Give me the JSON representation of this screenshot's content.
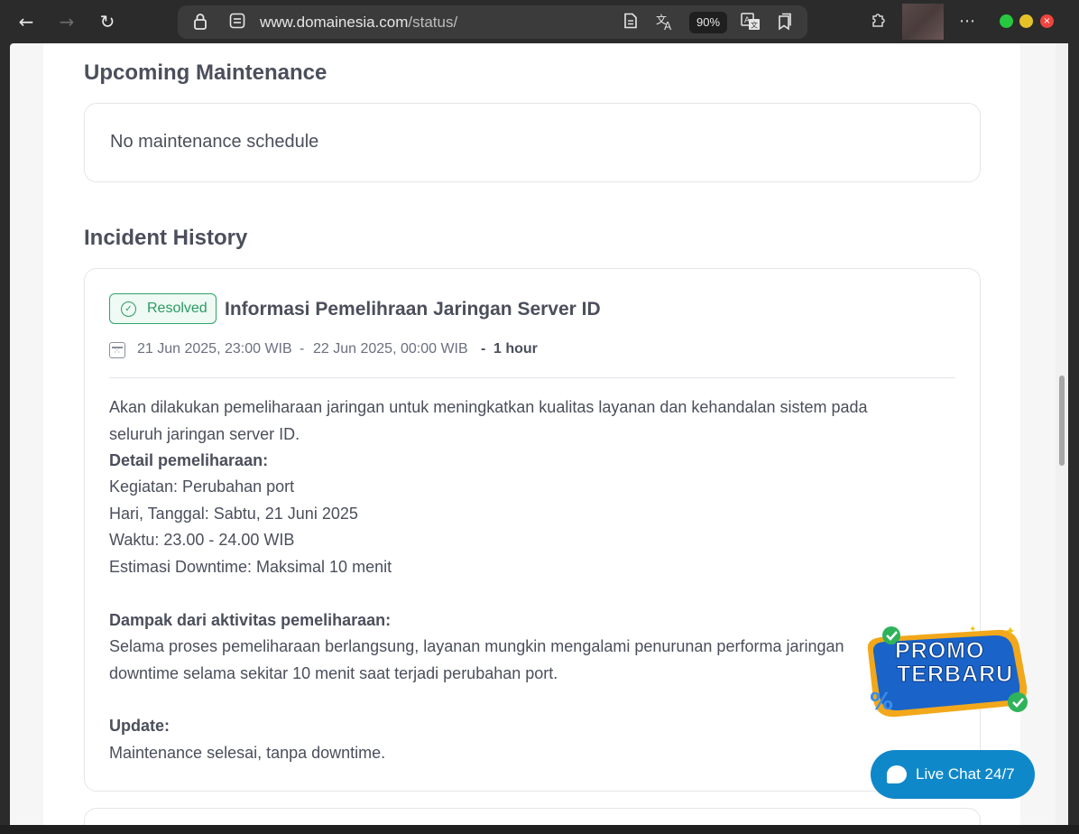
{
  "browser": {
    "url_host": "www.domainesia.com",
    "url_path": "/status/",
    "zoom": "90%",
    "more_menu": "⋯"
  },
  "maintenance": {
    "title": "Upcoming Maintenance",
    "empty_text": "No maintenance schedule"
  },
  "history": {
    "title": "Incident History",
    "incident": {
      "status": "Resolved",
      "status_color": "#2a9a63",
      "title": "Informasi Pemelihraan Jaringan Server ID",
      "start": "21 Jun 2025, 23:00 WIB",
      "sep1": "-",
      "end": "22 Jun 2025, 00:00 WIB",
      "sep2": "-",
      "duration": "1 hour",
      "lines": [
        "Akan dilakukan pemeliharaan jaringan untuk meningkatkan kualitas layanan dan kehandalan sistem pada",
        "seluruh jaringan server ID.",
        "Detail pemeliharaan:",
        "Kegiatan: Perubahan port",
        "Hari, Tanggal: Sabtu, 21 Juni 2025",
        "Waktu: 23.00 - 24.00 WIB",
        "Estimasi Downtime: Maksimal 10 menit",
        "Dampak dari aktivitas pemeliharaan:",
        "Selama proses pemeliharaan berlangsung, layanan mungkin mengalami penurunan performa jaringan",
        "downtime selama sekitar 10 menit saat terjadi perubahan port.",
        "Update:",
        "Maintenance selesai, tanpa downtime."
      ]
    }
  },
  "promo": {
    "line1": "PROMO",
    "line2": "TERBARU"
  },
  "livechat": {
    "label": "Live Chat 24/7",
    "color": "#0f88c9"
  }
}
